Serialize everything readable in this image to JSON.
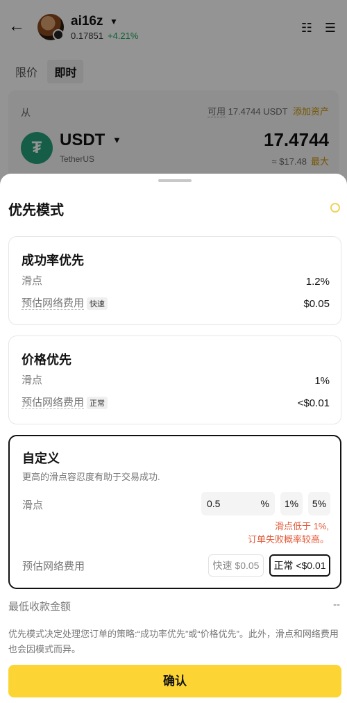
{
  "header": {
    "coin_name": "ai16z",
    "price": "0.17851",
    "change": "+4.21%"
  },
  "tabs": [
    {
      "label": "限价",
      "active": false
    },
    {
      "label": "即时",
      "active": true
    }
  ],
  "from_card": {
    "from_label": "从",
    "available_label": "可用",
    "available_value": "17.4744 USDT",
    "add_funds": "添加资产",
    "token_symbol": "USDT",
    "token_name": "TetherUS",
    "amount": "17.4744",
    "usd_value": "≈ $17.48",
    "max": "最大"
  },
  "sheet": {
    "title": "优先模式",
    "options": [
      {
        "title": "成功率优先",
        "slippage_label": "滑点",
        "slippage_value": "1.2%",
        "fee_label": "预估网络费用",
        "fee_tag": "快速",
        "fee_value": "$0.05"
      },
      {
        "title": "价格优先",
        "slippage_label": "滑点",
        "slippage_value": "1%",
        "fee_label": "预估网络费用",
        "fee_tag": "正常",
        "fee_value": "<$0.01"
      }
    ],
    "custom": {
      "title": "自定义",
      "description": "更高的滑点容忍度有助于交易成功.",
      "slippage_label": "滑点",
      "slippage_input_value": "0.5",
      "slippage_unit": "%",
      "chip_1": "1%",
      "chip_2": "5%",
      "warning_line1": "滑点低于 1%,",
      "warning_line2": "订单失败概率较高。",
      "fee_label": "预估网络费用",
      "fee_fast": "快速 $0.05",
      "fee_normal": "正常 <$0.01"
    },
    "min_receive_label": "最低收款金额",
    "min_receive_value": "--",
    "note": "优先模式决定处理您订单的策略:“成功率优先”或“价格优先”。此外，滑点和网络费用也会因模式而异。",
    "confirm": "确认"
  },
  "colors": {
    "accent_yellow": "#fcd535",
    "gain_green": "#1aa65a",
    "warning_red": "#e35a3a",
    "tether_green": "#26a17b"
  }
}
